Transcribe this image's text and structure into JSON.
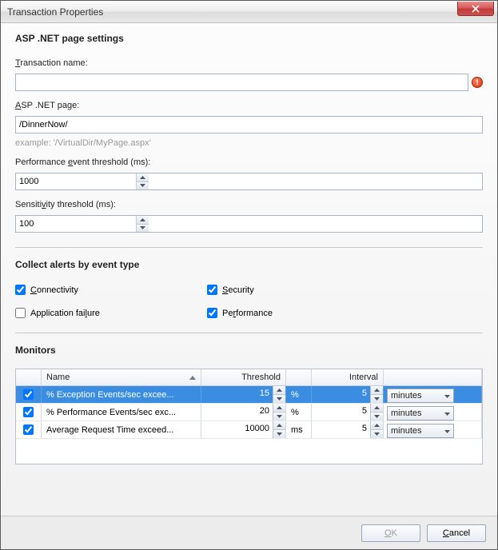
{
  "window": {
    "title": "Transaction Properties"
  },
  "section1": {
    "title": "ASP .NET page settings",
    "txn_name_label": "Transaction name:",
    "txn_name_value": "",
    "asp_page_label": "ASP .NET page:",
    "asp_page_value": "/DinnerNow/",
    "asp_page_hint": "example: '/VirtualDir/MyPage.aspx'",
    "perf_threshold_label": "Performance event threshold (ms):",
    "perf_threshold_value": "1000",
    "sensitivity_label": "Sensitivity threshold (ms):",
    "sensitivity_value": "100"
  },
  "section2": {
    "title": "Collect alerts by event type",
    "connectivity": {
      "label": "Connectivity",
      "checked": true
    },
    "security": {
      "label": "Security",
      "checked": true
    },
    "app_failure": {
      "label": "Application failure",
      "checked": false
    },
    "performance": {
      "label": "Performance",
      "checked": true
    }
  },
  "section3": {
    "title": "Monitors",
    "headers": {
      "name": "Name",
      "threshold": "Threshold",
      "interval": "Interval"
    },
    "rows": [
      {
        "checked": true,
        "name": "% Exception Events/sec excee...",
        "threshold": "15",
        "unit": "%",
        "interval": "5",
        "interval_unit": "minutes",
        "selected": true
      },
      {
        "checked": true,
        "name": "% Performance Events/sec exc...",
        "threshold": "20",
        "unit": "%",
        "interval": "5",
        "interval_unit": "minutes",
        "selected": false
      },
      {
        "checked": true,
        "name": "Average Request Time exceed...",
        "threshold": "10000",
        "unit": "ms",
        "interval": "5",
        "interval_unit": "minutes",
        "selected": false
      }
    ]
  },
  "footer": {
    "ok": "OK",
    "cancel": "Cancel"
  }
}
